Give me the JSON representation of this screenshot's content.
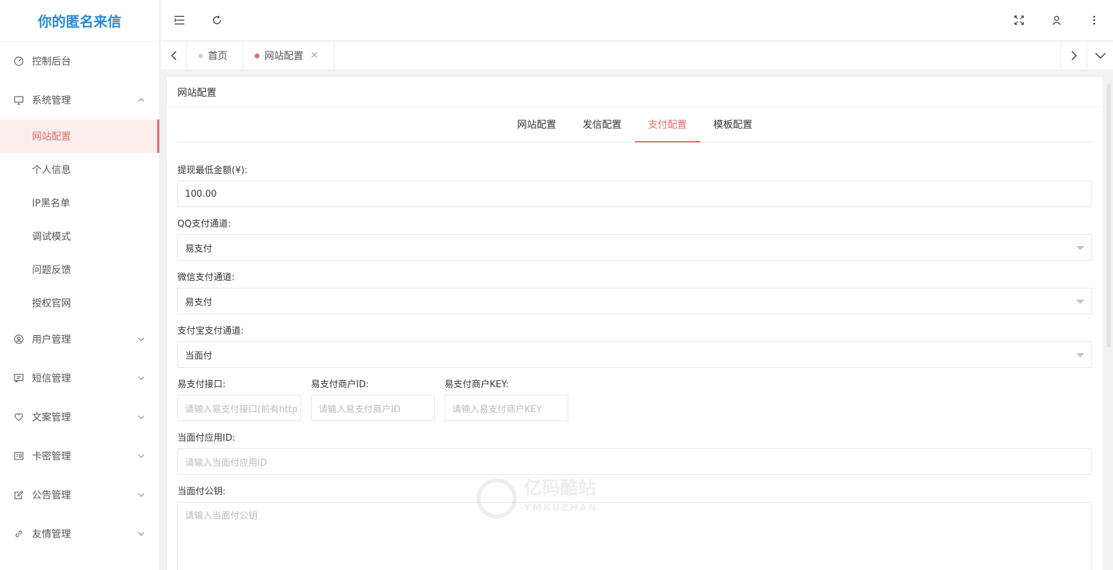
{
  "app": {
    "title": "你的匿名来信"
  },
  "sidebar": {
    "items": [
      {
        "label": "控制后台",
        "icon": "dashboard-icon"
      },
      {
        "label": "系统管理",
        "icon": "monitor-icon",
        "expanded": true,
        "children": [
          {
            "label": "网站配置",
            "active": true
          },
          {
            "label": "个人信息"
          },
          {
            "label": "IP黑名单"
          },
          {
            "label": "调试模式"
          },
          {
            "label": "问题反馈"
          },
          {
            "label": "授权官网"
          }
        ]
      },
      {
        "label": "用户管理",
        "icon": "user-circle-icon"
      },
      {
        "label": "短信管理",
        "icon": "message-icon"
      },
      {
        "label": "文案管理",
        "icon": "heart-icon"
      },
      {
        "label": "卡密管理",
        "icon": "card-icon"
      },
      {
        "label": "公告管理",
        "icon": "edit-icon"
      },
      {
        "label": "友情管理",
        "icon": "link-icon"
      }
    ]
  },
  "page_tabs": [
    {
      "label": "首页",
      "active": false
    },
    {
      "label": "网站配置",
      "active": true
    }
  ],
  "card": {
    "title": "网站配置",
    "tabs": [
      "网站配置",
      "发信配置",
      "支付配置",
      "模板配置"
    ],
    "active_tab": "支付配置"
  },
  "form": {
    "min_withdraw": {
      "label": "提现最低金额(¥):",
      "value": "100.00"
    },
    "qq_channel": {
      "label": "QQ支付通道:",
      "value": "易支付"
    },
    "wechat_channel": {
      "label": "微信支付通道:",
      "value": "易支付"
    },
    "alipay_channel": {
      "label": "支付宝支付通道:",
      "value": "当面付"
    },
    "epay_api": {
      "label": "易支付接口:",
      "placeholder": "请输入易支付接口(前有http"
    },
    "epay_merchant_id": {
      "label": "易支付商户ID:",
      "placeholder": "请输入易支付商户ID"
    },
    "epay_merchant_key": {
      "label": "易支付商户KEY:",
      "placeholder": "请输入易支付商户KEY"
    },
    "f2f_app_id": {
      "label": "当面付应用ID:",
      "placeholder": "请输入当面付应用ID"
    },
    "f2f_public_key": {
      "label": "当面付公钥:",
      "placeholder": "请输入当面付公钥"
    }
  },
  "watermark": {
    "text": "亿码酷站",
    "sub": "YMKUZHAN"
  },
  "colors": {
    "accent": "#e06c6c",
    "brand": "#2b8ad6"
  }
}
